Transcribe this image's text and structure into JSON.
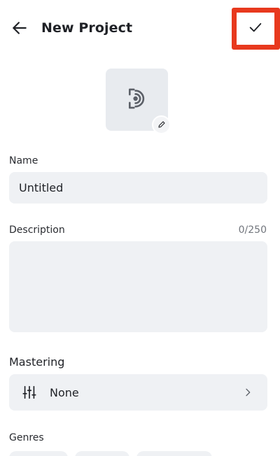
{
  "header": {
    "title": "New Project",
    "back_icon": "arrow-left-icon",
    "confirm_icon": "check-icon",
    "highlight_color": "#e8391e"
  },
  "cover": {
    "placeholder_icon": "music-file-icon",
    "edit_icon": "pencil-icon"
  },
  "form": {
    "name": {
      "label": "Name",
      "value": "Untitled"
    },
    "description": {
      "label": "Description",
      "counter": "0/250",
      "value": ""
    },
    "mastering": {
      "label": "Mastering",
      "value": "None",
      "icon": "equalizer-icon",
      "chevron_icon": "chevron-right-icon"
    },
    "genres": {
      "label": "Genres"
    }
  },
  "colors": {
    "accent": "#e8391e",
    "field_bg": "#eff1f4",
    "cover_bg": "#e8ebef",
    "icon": "#5c6068"
  }
}
